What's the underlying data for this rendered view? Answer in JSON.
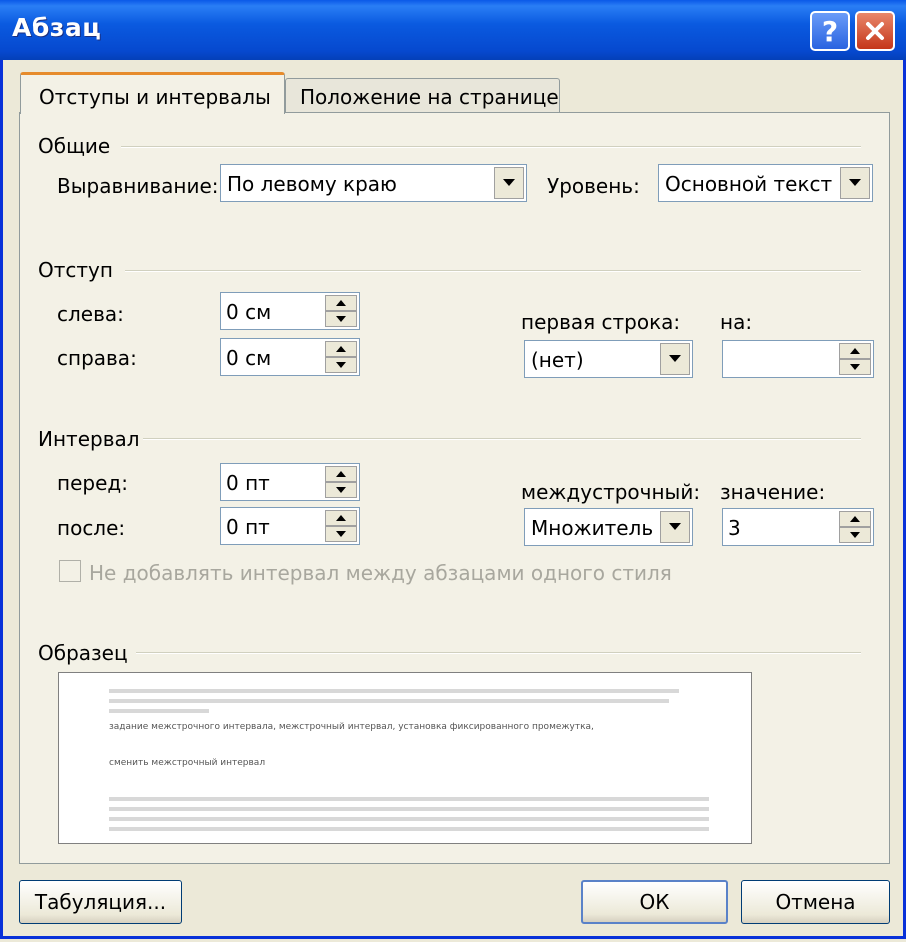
{
  "window": {
    "title": "Абзац"
  },
  "tabs": [
    {
      "label": "Отступы и интервалы"
    },
    {
      "label": "Положение на странице"
    }
  ],
  "general": {
    "group_label": "Общие",
    "alignment_label": "Выравнивание:",
    "alignment_value": "По левому краю",
    "level_label": "Уровень:",
    "level_value": "Основной текст"
  },
  "indent": {
    "group_label": "Отступ",
    "left_label": "слева:",
    "left_value": "0 см",
    "right_label": "справа:",
    "right_value": "0 см",
    "first_line_label": "первая строка:",
    "first_line_value": "(нет)",
    "by_label": "на:",
    "by_value": ""
  },
  "spacing": {
    "group_label": "Интервал",
    "before_label": "перед:",
    "before_value": "0 пт",
    "after_label": "после:",
    "after_value": "0 пт",
    "line_label": "междустрочный:",
    "line_value": "Множитель",
    "at_label": "значение:",
    "at_value": "3",
    "no_space_checkbox": "Не добавлять интервал между абзацами одного стиля"
  },
  "preview": {
    "group_label": "Образец",
    "line1": "задание межстрочного интервала, межстрочный интервал, установка фиксированного промежутка,",
    "line2": "сменить межстрочный интервал"
  },
  "buttons": {
    "tabs": "Табуляция...",
    "ok": "ОК",
    "cancel": "Отмена"
  }
}
